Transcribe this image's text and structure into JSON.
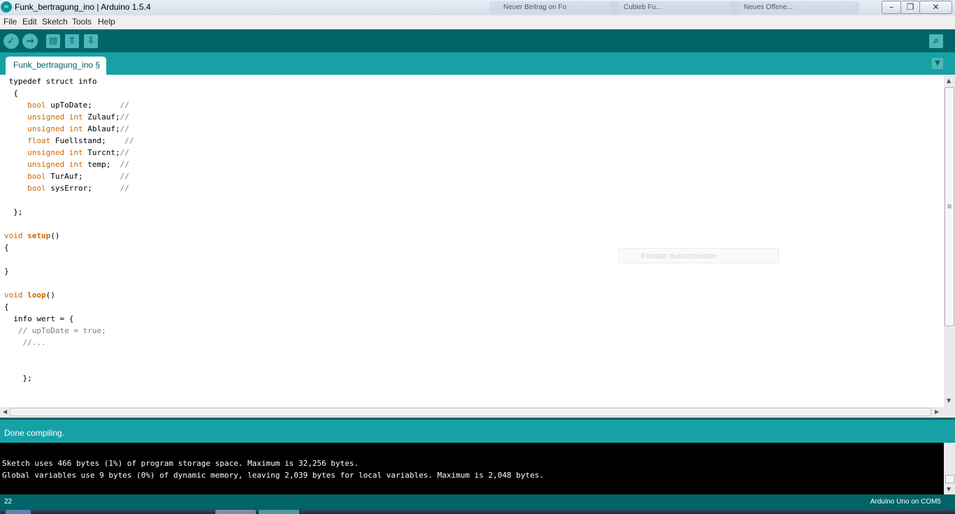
{
  "window": {
    "title": "Funk_bertragung_ino | Arduino 1.5.4",
    "app_icon": "arduino-logo-icon",
    "background_tabs": [
      "Neuer Beitrag on Fo",
      "Cubieb Fu...",
      "Neues Offene..."
    ],
    "controls": {
      "minimize": "minimize-icon",
      "maximize": "maximize-icon",
      "close": "close-icon"
    }
  },
  "menu": [
    "File",
    "Edit",
    "Sketch",
    "Tools",
    "Help"
  ],
  "toolbar": {
    "buttons": [
      "verify-icon",
      "upload-icon",
      "new-icon",
      "open-icon",
      "save-icon"
    ],
    "serial_monitor": "serial-monitor-icon"
  },
  "tabs": {
    "active": "Funk_bertragung_ino §",
    "menu_icon": "tab-menu-icon"
  },
  "code": [
    {
      "parts": [
        {
          "t": "typedef struct info",
          "c": ""
        }
      ],
      "indent": " "
    },
    {
      "parts": [
        {
          "t": "{",
          "c": ""
        }
      ],
      "indent": "  "
    },
    {
      "parts": [
        {
          "t": "bool",
          "c": "kw"
        },
        {
          "t": " upToDate;      ",
          "c": ""
        },
        {
          "t": "//",
          "c": "cm"
        }
      ],
      "indent": "     "
    },
    {
      "parts": [
        {
          "t": "unsigned int",
          "c": "kw"
        },
        {
          "t": " Zulauf;",
          "c": ""
        },
        {
          "t": "//",
          "c": "cm"
        }
      ],
      "indent": "     "
    },
    {
      "parts": [
        {
          "t": "unsigned int",
          "c": "kw"
        },
        {
          "t": " Ablauf;",
          "c": ""
        },
        {
          "t": "//",
          "c": "cm"
        }
      ],
      "indent": "     "
    },
    {
      "parts": [
        {
          "t": "float",
          "c": "kw"
        },
        {
          "t": " Fuellstand;    ",
          "c": ""
        },
        {
          "t": "//",
          "c": "cm"
        }
      ],
      "indent": "     "
    },
    {
      "parts": [
        {
          "t": "unsigned int",
          "c": "kw"
        },
        {
          "t": " Turcnt;",
          "c": ""
        },
        {
          "t": "//",
          "c": "cm"
        }
      ],
      "indent": "     "
    },
    {
      "parts": [
        {
          "t": "unsigned int",
          "c": "kw"
        },
        {
          "t": " temp;  ",
          "c": ""
        },
        {
          "t": "//",
          "c": "cm"
        }
      ],
      "indent": "     "
    },
    {
      "parts": [
        {
          "t": "bool",
          "c": "kw"
        },
        {
          "t": " TurAuf;        ",
          "c": ""
        },
        {
          "t": "//",
          "c": "cm"
        }
      ],
      "indent": "     "
    },
    {
      "parts": [
        {
          "t": "bool",
          "c": "kw"
        },
        {
          "t": " sysError;      ",
          "c": ""
        },
        {
          "t": "//",
          "c": "cm"
        }
      ],
      "indent": "     "
    },
    {
      "parts": [],
      "indent": ""
    },
    {
      "parts": [
        {
          "t": "};",
          "c": ""
        }
      ],
      "indent": "  "
    },
    {
      "parts": [],
      "indent": ""
    },
    {
      "parts": [
        {
          "t": "void",
          "c": "kw"
        },
        {
          "t": " ",
          "c": ""
        },
        {
          "t": "setup",
          "c": "fn"
        },
        {
          "t": "()",
          "c": ""
        }
      ],
      "indent": ""
    },
    {
      "parts": [
        {
          "t": "{",
          "c": ""
        }
      ],
      "indent": ""
    },
    {
      "parts": [],
      "indent": ""
    },
    {
      "parts": [
        {
          "t": "}",
          "c": ""
        }
      ],
      "indent": ""
    },
    {
      "parts": [],
      "indent": ""
    },
    {
      "parts": [
        {
          "t": "void",
          "c": "kw"
        },
        {
          "t": " ",
          "c": ""
        },
        {
          "t": "loop",
          "c": "fn"
        },
        {
          "t": "()",
          "c": ""
        }
      ],
      "indent": ""
    },
    {
      "parts": [
        {
          "t": "{",
          "c": ""
        }
      ],
      "indent": ""
    },
    {
      "parts": [
        {
          "t": "info wert = {",
          "c": ""
        }
      ],
      "indent": "  "
    },
    {
      "parts": [
        {
          "t": "// upToDate = true;",
          "c": "cm"
        }
      ],
      "indent": "   "
    },
    {
      "parts": [
        {
          "t": "//...",
          "c": "cm"
        }
      ],
      "indent": "    "
    },
    {
      "parts": [],
      "indent": ""
    },
    {
      "parts": [],
      "indent": ""
    },
    {
      "parts": [
        {
          "t": "};",
          "c": ""
        }
      ],
      "indent": "    "
    }
  ],
  "ghost_tooltip": "Fenster ausschneiden",
  "status": "Done compiling.",
  "console": [
    "Sketch uses 466 bytes (1%) of program storage space. Maximum is 32,256 bytes.",
    "Global variables use 9 bytes (0%) of dynamic memory, leaving 2,039 bytes for local variables. Maximum is 2,048 bytes."
  ],
  "footer": {
    "line": "22",
    "board": "Arduino Uno on COM5"
  },
  "colors": {
    "teal_dark": "#006468",
    "teal": "#17a1a5",
    "keyword": "#cc6600",
    "comment": "#7e7e7e"
  }
}
